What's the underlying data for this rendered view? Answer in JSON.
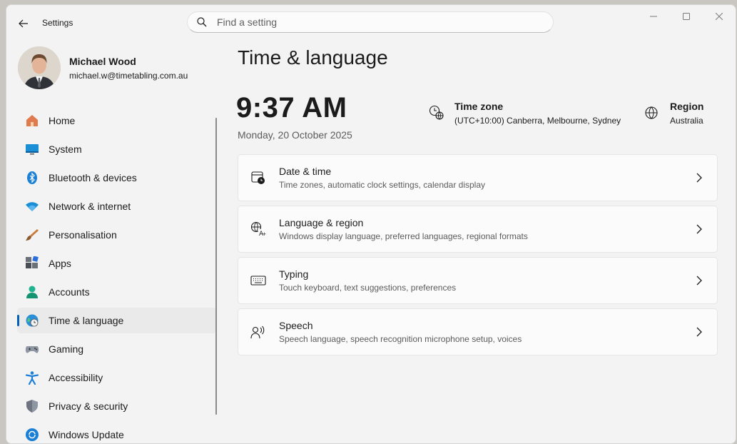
{
  "window": {
    "app_title": "Settings"
  },
  "search": {
    "placeholder": "Find a setting"
  },
  "profile": {
    "name": "Michael Wood",
    "email": "michael.w@timetabling.com.au"
  },
  "nav": {
    "items": [
      {
        "label": "Home",
        "icon": "home-icon"
      },
      {
        "label": "System",
        "icon": "system-icon"
      },
      {
        "label": "Bluetooth & devices",
        "icon": "bluetooth-icon"
      },
      {
        "label": "Network & internet",
        "icon": "wifi-icon"
      },
      {
        "label": "Personalisation",
        "icon": "brush-icon"
      },
      {
        "label": "Apps",
        "icon": "apps-icon"
      },
      {
        "label": "Accounts",
        "icon": "person-icon"
      },
      {
        "label": "Time & language",
        "icon": "globe-clock-icon",
        "active": true
      },
      {
        "label": "Gaming",
        "icon": "gamepad-icon"
      },
      {
        "label": "Accessibility",
        "icon": "accessibility-icon"
      },
      {
        "label": "Privacy & security",
        "icon": "shield-icon"
      },
      {
        "label": "Windows Update",
        "icon": "update-icon"
      }
    ]
  },
  "main": {
    "title": "Time & language",
    "clock": "9:37 AM",
    "date": "Monday, 20 October 2025",
    "time_zone": {
      "label": "Time zone",
      "value": "(UTC+10:00) Canberra, Melbourne, Sydney"
    },
    "region": {
      "label": "Region",
      "value": "Australia"
    },
    "cards": [
      {
        "title": "Date & time",
        "subtitle": "Time zones, automatic clock settings, calendar display",
        "icon": "calendar-clock-icon"
      },
      {
        "title": "Language & region",
        "subtitle": "Windows display language, preferred languages, regional formats",
        "icon": "language-icon"
      },
      {
        "title": "Typing",
        "subtitle": "Touch keyboard, text suggestions, preferences",
        "icon": "keyboard-icon"
      },
      {
        "title": "Speech",
        "subtitle": "Speech language, speech recognition microphone setup, voices",
        "icon": "speech-icon"
      }
    ]
  },
  "colors": {
    "accent": "#005fb8",
    "window_bg": "#f3f3f3",
    "card_bg": "#fbfbfb"
  }
}
